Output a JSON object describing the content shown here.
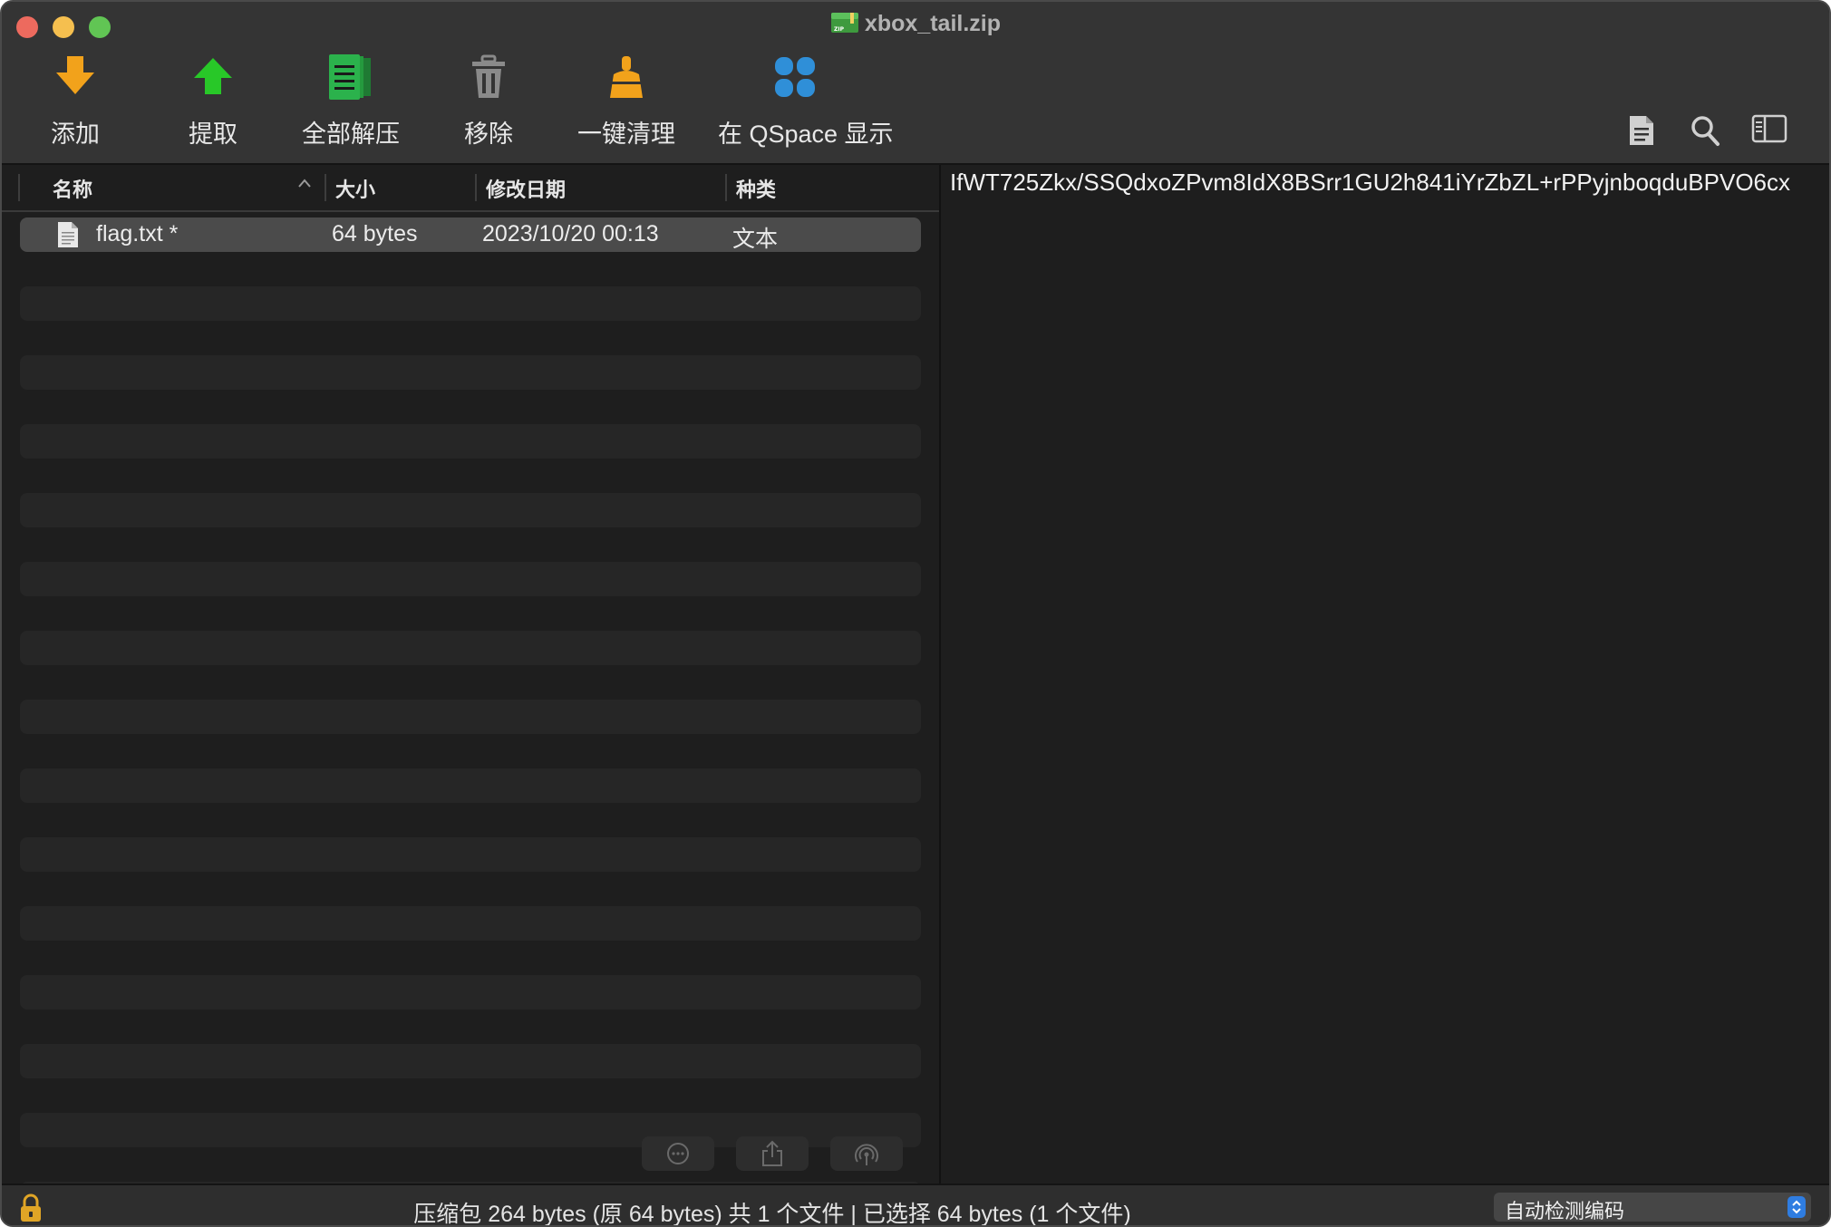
{
  "window": {
    "title": "xbox_tail.zip"
  },
  "toolbar": {
    "add": "添加",
    "extract": "提取",
    "extract_all": "全部解压",
    "remove": "移除",
    "clean": "一键清理",
    "show_in_qspace": "在 QSpace 显示"
  },
  "columns": {
    "name": "名称",
    "size": "大小",
    "modified": "修改日期",
    "kind": "种类"
  },
  "files": [
    {
      "name": "flag.txt *",
      "size": "64 bytes",
      "modified": "2023/10/20 00:13",
      "kind": "文本"
    }
  ],
  "preview": {
    "content": "IfWT725Zkx/SSQdxoZPvm8IdX8BSrr1GU2h841iYrZbZL+rPPyjnboqduBPVO6cx"
  },
  "status": {
    "summary": "压缩包 264 bytes (原 64 bytes) 共 1 个文件  |  已选择 64 bytes (1 个文件)",
    "encoding": "自动检测编码"
  },
  "colors": {
    "add_icon": "#f2a21b",
    "extract_icon": "#28c828",
    "extract_all_icon": "#2bb24c",
    "remove_icon": "#8a8a8a",
    "clean_icon": "#f2a21b",
    "qspace_icon": "#2f8fd8",
    "close": "#ed6a5e",
    "minimize": "#f5bf4f",
    "maximize": "#61c554"
  },
  "icons": {
    "add": "download-arrow-icon",
    "extract": "upload-arrow-icon",
    "extract_all": "document-stack-icon",
    "remove": "trash-icon",
    "clean": "broom-icon",
    "qspace": "four-leaf-icon",
    "preview_mode": "document-icon",
    "search": "search-icon",
    "sidebar": "sidebar-icon"
  }
}
